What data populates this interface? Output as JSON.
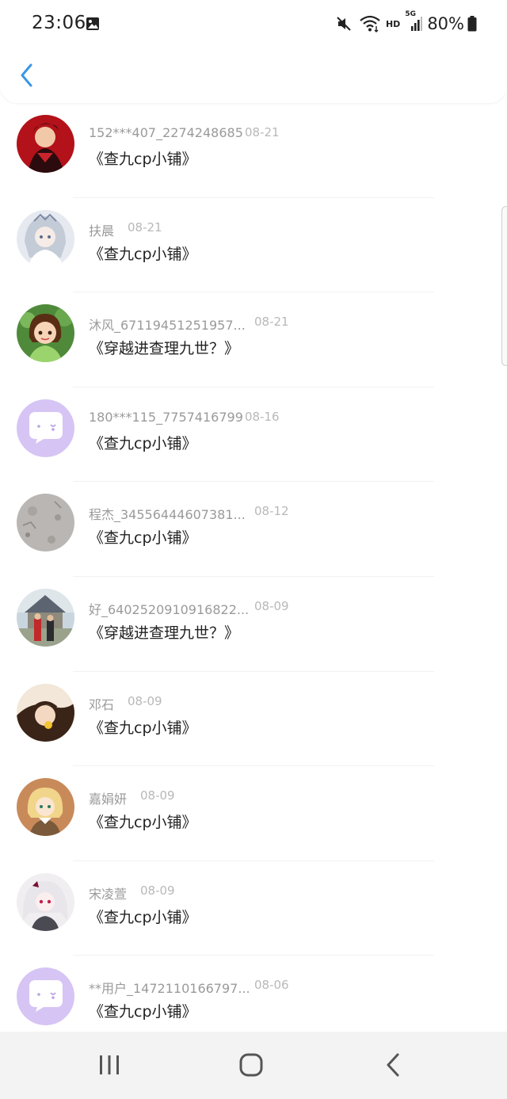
{
  "status_bar": {
    "time": "23:06",
    "network": "HD",
    "cellular": "5G",
    "battery": "80%"
  },
  "header": {
    "back_icon": "chevron-left-icon"
  },
  "comments": [
    {
      "user": "152***407_2274248685",
      "date": "08-21",
      "book": "《查九cp小铺》",
      "avatar": "dark-anime-character"
    },
    {
      "user": "扶晨",
      "date": "08-21",
      "book": "《查九cp小铺》",
      "avatar": "anime-girl-light"
    },
    {
      "user": "沐风_67119451251957...",
      "date": "08-21",
      "book": "《穿越进查理九世？》",
      "avatar": "cartoon-girl-green"
    },
    {
      "user": "180***115_7757416799",
      "date": "08-16",
      "book": "《查九cp小铺》",
      "avatar": "default-chat-bubble"
    },
    {
      "user": "程杰_34556444607381...",
      "date": "08-12",
      "book": "《查九cp小铺》",
      "avatar": "grey-photo"
    },
    {
      "user": "好_6402520910916822...",
      "date": "08-09",
      "book": "《穿越进查理九世？》",
      "avatar": "people-outdoors"
    },
    {
      "user": "邓石",
      "date": "08-09",
      "book": "《查九cp小铺》",
      "avatar": "girl-photo"
    },
    {
      "user": "嘉娟妍",
      "date": "08-09",
      "book": "《查九cp小铺》",
      "avatar": "blonde-anime"
    },
    {
      "user": "宋凌萱",
      "date": "08-09",
      "book": "《查九cp小铺》",
      "avatar": "white-hair-anime"
    },
    {
      "user": "**用户_1472110166797...",
      "date": "08-06",
      "book": "《查九cp小铺》",
      "avatar": "default-chat-bubble"
    }
  ],
  "nav": {
    "recents_icon": "recents-icon",
    "home_icon": "home-icon",
    "back_icon": "back-icon"
  },
  "colors": {
    "accent": "#3a97e8",
    "default_avatar": "#d6c4f5",
    "name_text": "#9a9a9a",
    "book_text": "#222222"
  }
}
